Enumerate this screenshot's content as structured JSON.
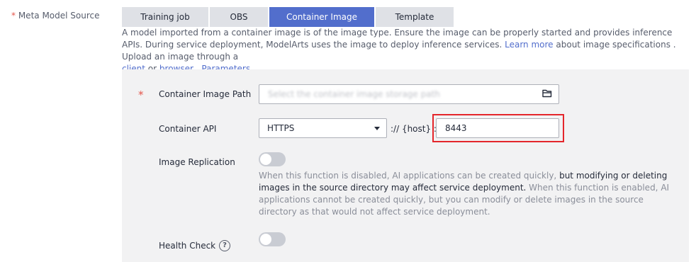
{
  "meta_model_source": {
    "required_mark": "*",
    "label": "Meta Model Source",
    "tabs": [
      {
        "label": "Training job",
        "active": false
      },
      {
        "label": "OBS",
        "active": false
      },
      {
        "label": "Container Image",
        "active": true
      },
      {
        "label": "Template",
        "active": false
      }
    ],
    "description": {
      "text_1": "A model imported from a container image is of the image type. Ensure the image can be properly started and provides inference APIs. During service deployment, ModelArts uses the image to deploy inference services.",
      "learn_more": "Learn more",
      "text_2": "about image specifications . Upload an image through a",
      "client": "client",
      "or": "or",
      "browser": "browser",
      "dot": ".",
      "parameters": "Parameters"
    }
  },
  "container_image_path": {
    "required_mark": "*",
    "label": "Container Image Path",
    "placeholder": "Select the container image storage path",
    "icon": "folder-open-icon"
  },
  "container_api": {
    "label": "Container API",
    "protocol": "HTTPS",
    "host_text": ":// {host} :",
    "port": "8443",
    "highlight_color": "#e4262b"
  },
  "image_replication": {
    "label": "Image Replication",
    "enabled": false,
    "note_1": "When this function is disabled, AI applications can be created quickly,",
    "note_bold": "but modifying or deleting images in the source directory may affect service deployment.",
    "note_2": "When this function is enabled, AI applications cannot be created quickly, but you can modify or delete images in the source directory as that would not affect service deployment."
  },
  "health_check": {
    "label": "Health Check",
    "help": "?",
    "enabled": false
  },
  "colors": {
    "accent": "#526ecc",
    "required": "#e4554b"
  }
}
